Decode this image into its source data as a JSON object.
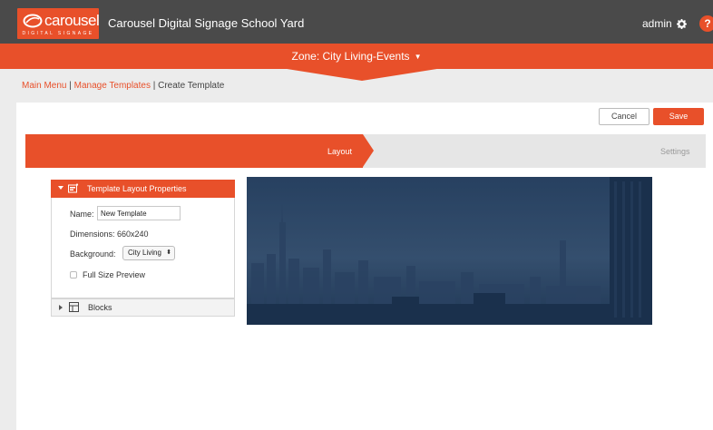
{
  "app": {
    "logo_text": "carousel",
    "logo_subtext": "DIGITAL SIGNAGE",
    "title": "Carousel Digital Signage School Yard",
    "user": "admin",
    "help_label": "?"
  },
  "zone": {
    "label": "Zone: City Living-Events",
    "caret": "▼"
  },
  "breadcrumb": {
    "items": [
      "Main Menu",
      "Manage Templates",
      "Create Template"
    ],
    "separator": "|"
  },
  "actions": {
    "cancel_label": "Cancel",
    "save_label": "Save"
  },
  "steps": {
    "active": "Layout",
    "inactive": "Settings"
  },
  "properties": {
    "title": "Template Layout Properties",
    "name_label": "Name:",
    "name_value": "New Template",
    "dimensions_label": "Dimensions: 660x240",
    "background_label": "Background:",
    "background_value": "City Living",
    "full_size_label": "Full Size Preview",
    "full_size_checked": false
  },
  "blocks": {
    "label": "Blocks"
  },
  "colors": {
    "accent": "#e8502a",
    "topbar": "#4a4a4a",
    "preview_sky": "#2e4868"
  }
}
